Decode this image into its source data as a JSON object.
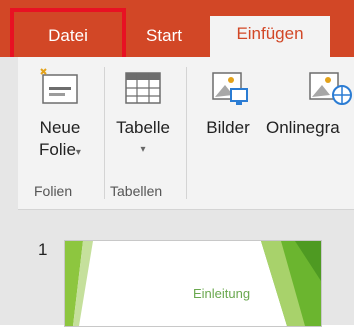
{
  "tabs": {
    "datei": "Datei",
    "start": "Start",
    "einfuegen": "Einfügen"
  },
  "ribbon": {
    "neue_folie_line1": "Neue",
    "neue_folie_line2": "Folie",
    "tabelle": "Tabelle",
    "bilder": "Bilder",
    "onlinegrafiken": "Onlinegra",
    "group_folien": "Folien",
    "group_tabellen": "Tabellen"
  },
  "slides": {
    "number": "1",
    "thumbnail_text": "Einleitung"
  },
  "colors": {
    "accent": "#d24726",
    "highlight": "#e81123",
    "slide_green": "#6aa84f"
  }
}
